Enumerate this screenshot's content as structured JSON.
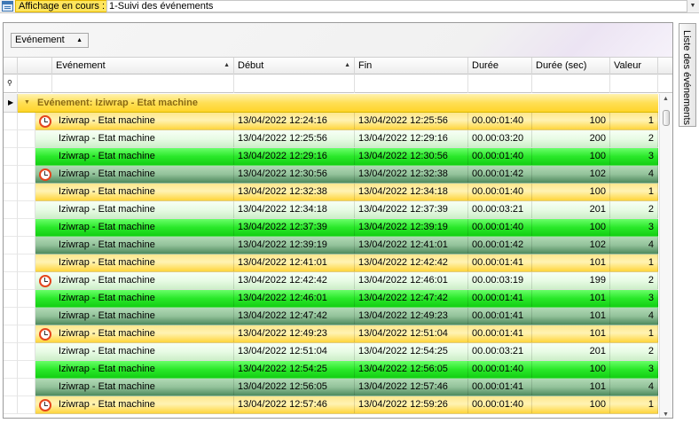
{
  "display": {
    "label": "Affichage en cours :",
    "value": "1-Suivi des événements"
  },
  "group_by": {
    "label": "Evénement"
  },
  "side_tab": {
    "label": "Liste des événements"
  },
  "columns": [
    {
      "key": "evenement",
      "label": "Evénement",
      "sorted": true
    },
    {
      "key": "debut",
      "label": "Début",
      "sorted": true
    },
    {
      "key": "fin",
      "label": "Fin",
      "sorted": false
    },
    {
      "key": "duree",
      "label": "Durée",
      "sorted": false
    },
    {
      "key": "duree_sec",
      "label": "Durée (sec)",
      "sorted": false
    },
    {
      "key": "valeur",
      "label": "Valeur",
      "sorted": false
    }
  ],
  "group": {
    "label": "Evénement: Iziwrap - Etat machine"
  },
  "colors": {
    "group_bar": "#ffdf55",
    "value1": "#ffd53c",
    "value2": "#e8fbe5",
    "value3": "#2ae82a",
    "value4": "#93c29a",
    "alarm": "#e5441c"
  },
  "rows": [
    {
      "alarm": true,
      "event": "Iziwrap - Etat machine",
      "start": "13/04/2022 12:24:16",
      "end": "13/04/2022 12:25:56",
      "duration": "00.00:01:40",
      "seconds": "100",
      "value": "1"
    },
    {
      "alarm": false,
      "event": "Iziwrap - Etat machine",
      "start": "13/04/2022 12:25:56",
      "end": "13/04/2022 12:29:16",
      "duration": "00.00:03:20",
      "seconds": "200",
      "value": "2"
    },
    {
      "alarm": false,
      "event": "Iziwrap - Etat machine",
      "start": "13/04/2022 12:29:16",
      "end": "13/04/2022 12:30:56",
      "duration": "00.00:01:40",
      "seconds": "100",
      "value": "3"
    },
    {
      "alarm": true,
      "event": "Iziwrap - Etat machine",
      "start": "13/04/2022 12:30:56",
      "end": "13/04/2022 12:32:38",
      "duration": "00.00:01:42",
      "seconds": "102",
      "value": "4"
    },
    {
      "alarm": false,
      "event": "Iziwrap - Etat machine",
      "start": "13/04/2022 12:32:38",
      "end": "13/04/2022 12:34:18",
      "duration": "00.00:01:40",
      "seconds": "100",
      "value": "1"
    },
    {
      "alarm": false,
      "event": "Iziwrap - Etat machine",
      "start": "13/04/2022 12:34:18",
      "end": "13/04/2022 12:37:39",
      "duration": "00.00:03:21",
      "seconds": "201",
      "value": "2"
    },
    {
      "alarm": false,
      "event": "Iziwrap - Etat machine",
      "start": "13/04/2022 12:37:39",
      "end": "13/04/2022 12:39:19",
      "duration": "00.00:01:40",
      "seconds": "100",
      "value": "3"
    },
    {
      "alarm": false,
      "event": "Iziwrap - Etat machine",
      "start": "13/04/2022 12:39:19",
      "end": "13/04/2022 12:41:01",
      "duration": "00.00:01:42",
      "seconds": "102",
      "value": "4"
    },
    {
      "alarm": false,
      "event": "Iziwrap - Etat machine",
      "start": "13/04/2022 12:41:01",
      "end": "13/04/2022 12:42:42",
      "duration": "00.00:01:41",
      "seconds": "101",
      "value": "1"
    },
    {
      "alarm": true,
      "event": "Iziwrap - Etat machine",
      "start": "13/04/2022 12:42:42",
      "end": "13/04/2022 12:46:01",
      "duration": "00.00:03:19",
      "seconds": "199",
      "value": "2"
    },
    {
      "alarm": false,
      "event": "Iziwrap - Etat machine",
      "start": "13/04/2022 12:46:01",
      "end": "13/04/2022 12:47:42",
      "duration": "00.00:01:41",
      "seconds": "101",
      "value": "3"
    },
    {
      "alarm": false,
      "event": "Iziwrap - Etat machine",
      "start": "13/04/2022 12:47:42",
      "end": "13/04/2022 12:49:23",
      "duration": "00.00:01:41",
      "seconds": "101",
      "value": "4"
    },
    {
      "alarm": true,
      "event": "Iziwrap - Etat machine",
      "start": "13/04/2022 12:49:23",
      "end": "13/04/2022 12:51:04",
      "duration": "00.00:01:41",
      "seconds": "101",
      "value": "1"
    },
    {
      "alarm": false,
      "event": "Iziwrap - Etat machine",
      "start": "13/04/2022 12:51:04",
      "end": "13/04/2022 12:54:25",
      "duration": "00.00:03:21",
      "seconds": "201",
      "value": "2"
    },
    {
      "alarm": false,
      "event": "Iziwrap - Etat machine",
      "start": "13/04/2022 12:54:25",
      "end": "13/04/2022 12:56:05",
      "duration": "00.00:01:40",
      "seconds": "100",
      "value": "3"
    },
    {
      "alarm": false,
      "event": "Iziwrap - Etat machine",
      "start": "13/04/2022 12:56:05",
      "end": "13/04/2022 12:57:46",
      "duration": "00.00:01:41",
      "seconds": "101",
      "value": "4"
    },
    {
      "alarm": true,
      "event": "Iziwrap - Etat machine",
      "start": "13/04/2022 12:57:46",
      "end": "13/04/2022 12:59:26",
      "duration": "00.00:01:40",
      "seconds": "100",
      "value": "1"
    }
  ]
}
